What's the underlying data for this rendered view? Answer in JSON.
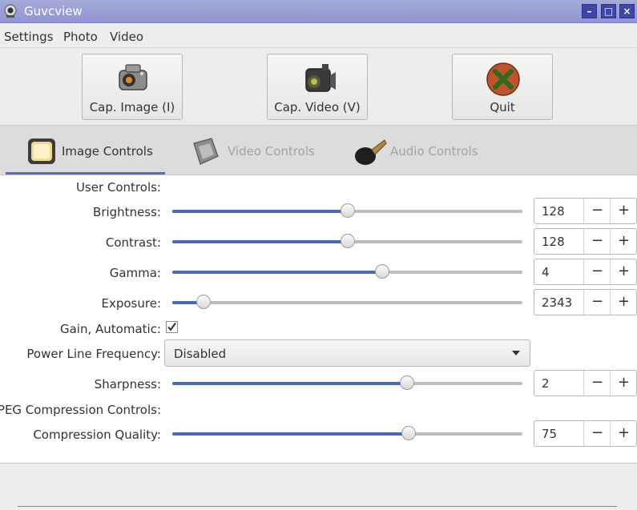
{
  "window": {
    "title": "Guvcview"
  },
  "menu": [
    "Settings",
    "Photo",
    "Video"
  ],
  "toolbar": {
    "cap_image": "Cap. Image (I)",
    "cap_video": "Cap. Video (V)",
    "quit": "Quit"
  },
  "tabs": [
    {
      "label": "Image Controls",
      "active": true
    },
    {
      "label": "Video Controls",
      "active": false
    },
    {
      "label": "Audio Controls",
      "active": false
    }
  ],
  "controls": {
    "user_section": "User Controls:",
    "brightness": {
      "label": "Brightness:",
      "value": "128",
      "fraction": 0.5
    },
    "contrast": {
      "label": "Contrast:",
      "value": "128",
      "fraction": 0.5
    },
    "gamma": {
      "label": "Gamma:",
      "value": "4",
      "fraction": 0.6
    },
    "exposure": {
      "label": "Exposure:",
      "value": "2343",
      "fraction": 0.09
    },
    "gain_auto": {
      "label": "Gain, Automatic:",
      "checked": true
    },
    "power_line": {
      "label": "Power Line Frequency:",
      "value": "Disabled"
    },
    "sharpness": {
      "label": "Sharpness:",
      "value": "2",
      "fraction": 0.67
    },
    "jpeg_section": "JPEG Compression Controls:",
    "compression": {
      "label": "Compression Quality:",
      "value": "75",
      "fraction": 0.675
    }
  },
  "spin_minus": "−",
  "spin_plus": "+",
  "colors": {
    "accent": "#4a6ab8",
    "titlebar": "#9ca1d6"
  }
}
